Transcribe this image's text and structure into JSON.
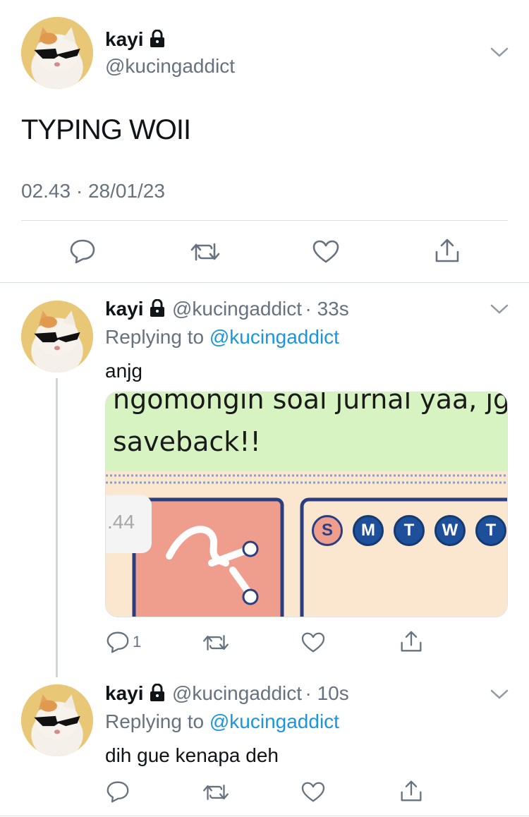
{
  "main_tweet": {
    "name": "kayi",
    "handle": "@kucingaddict",
    "text": "TYPING WOII",
    "timestamp": "02.43 · 28/01/23"
  },
  "reply_1": {
    "name": "kayi",
    "handle": "@kucingaddict",
    "time": "· 33s",
    "replying_prefix": "Replying to ",
    "replying_to": "@kucingaddict",
    "text": "anjg",
    "reply_count": "1",
    "media": {
      "line1": "ngomongin soal jurnal yaa, jg",
      "line2": "saveback!!",
      "time_fragment": ".44",
      "days": [
        "S",
        "M",
        "T",
        "W",
        "T"
      ]
    }
  },
  "reply_2": {
    "name": "kayi",
    "handle": "@kucingaddict",
    "time": "· 10s",
    "replying_prefix": "Replying to ",
    "replying_to": "@kucingaddict",
    "text": "dih gue kenapa deh"
  },
  "icons": [
    "reply-icon",
    "retweet-icon",
    "like-icon",
    "share-icon",
    "lock-icon",
    "chevron-down-icon"
  ],
  "colors": {
    "link": "#1b95e0",
    "muted": "#66727f",
    "text": "#0f1419"
  }
}
